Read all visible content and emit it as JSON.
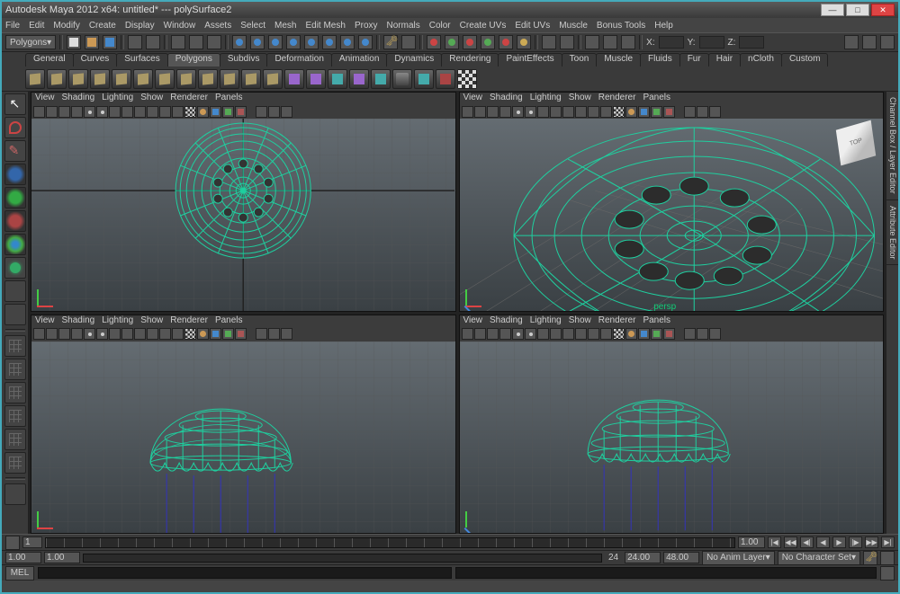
{
  "title": "Autodesk Maya 2012 x64: untitled*  ---  polySurface2",
  "menus": [
    "File",
    "Edit",
    "Modify",
    "Create",
    "Display",
    "Window",
    "Assets",
    "Select",
    "Mesh",
    "Edit Mesh",
    "Proxy",
    "Normals",
    "Color",
    "Create UVs",
    "Edit UVs",
    "Muscle",
    "Bonus Tools",
    "Help"
  ],
  "mode": "Polygons",
  "coord_labels": {
    "x": "X:",
    "y": "Y:",
    "z": "Z:"
  },
  "coords": {
    "x": "",
    "y": "",
    "z": ""
  },
  "shelf_tabs": [
    "General",
    "Curves",
    "Surfaces",
    "Polygons",
    "Subdivs",
    "Deformation",
    "Animation",
    "Dynamics",
    "Rendering",
    "PaintEffects",
    "Toon",
    "Muscle",
    "Fluids",
    "Fur",
    "Hair",
    "nCloth",
    "Custom"
  ],
  "shelf_active": "Polygons",
  "viewport_menus": [
    "View",
    "Shading",
    "Lighting",
    "Show",
    "Renderer",
    "Panels"
  ],
  "persp_label": "persp",
  "viewcube_face": "TOP",
  "right_tabs": [
    "Channel Box / Layer Editor",
    "Attribute Editor"
  ],
  "time": {
    "current": "1",
    "start": "1.00",
    "range_start": "1.00",
    "range_end": "24",
    "end_a": "24.00",
    "end_b": "48.00"
  },
  "status": {
    "anim_layer": "No Anim Layer",
    "char_set": "No Character Set"
  },
  "cmd_label": "MEL",
  "playback_icons": [
    "|◀",
    "◀◀",
    "◀|",
    "◀",
    "▶",
    "|▶",
    "▶▶",
    "▶|"
  ]
}
